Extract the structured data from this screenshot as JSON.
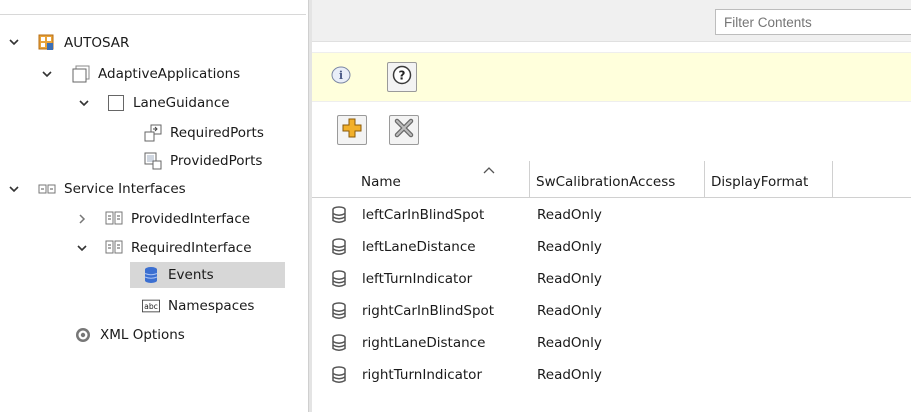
{
  "tree": {
    "nodes": [
      {
        "label": "AUTOSAR",
        "icon": "autosar-root-icon",
        "expander": "expanded"
      },
      {
        "label": "AdaptiveApplications",
        "icon": "package-icon",
        "expander": "expanded"
      },
      {
        "label": "LaneGuidance",
        "icon": "component-icon",
        "expander": "expanded"
      },
      {
        "label": "RequiredPorts",
        "icon": "required-ports-icon",
        "expander": "none"
      },
      {
        "label": "ProvidedPorts",
        "icon": "provided-ports-icon",
        "expander": "none"
      },
      {
        "label": "Service Interfaces",
        "icon": "service-interfaces-icon",
        "expander": "expanded"
      },
      {
        "label": "ProvidedInterface",
        "icon": "interface-icon",
        "expander": "collapsed"
      },
      {
        "label": "RequiredInterface",
        "icon": "interface-icon",
        "expander": "expanded"
      },
      {
        "label": "Events",
        "icon": "events-icon",
        "expander": "none",
        "selected": true
      },
      {
        "label": "Namespaces",
        "icon": "namespaces-icon",
        "expander": "none"
      },
      {
        "label": "XML Options",
        "icon": "xml-options-icon",
        "expander": "none"
      }
    ]
  },
  "filter": {
    "placeholder": "Filter Contents"
  },
  "table": {
    "columns": [
      "Name",
      "SwCalibrationAccess",
      "DisplayFormat"
    ],
    "rows": [
      {
        "name": "leftCarInBlindSpot",
        "access": "ReadOnly",
        "format": ""
      },
      {
        "name": "leftLaneDistance",
        "access": "ReadOnly",
        "format": ""
      },
      {
        "name": "leftTurnIndicator",
        "access": "ReadOnly",
        "format": ""
      },
      {
        "name": "rightCarInBlindSpot",
        "access": "ReadOnly",
        "format": ""
      },
      {
        "name": "rightLaneDistance",
        "access": "ReadOnly",
        "format": ""
      },
      {
        "name": "rightTurnIndicator",
        "access": "ReadOnly",
        "format": ""
      }
    ]
  },
  "colors": {
    "info_bar": "#ffffdc",
    "selection": "#d7d7d7",
    "add_icon": "#f2b02a",
    "db_icon": "#555555",
    "events_icon": "#3b6fd1"
  }
}
